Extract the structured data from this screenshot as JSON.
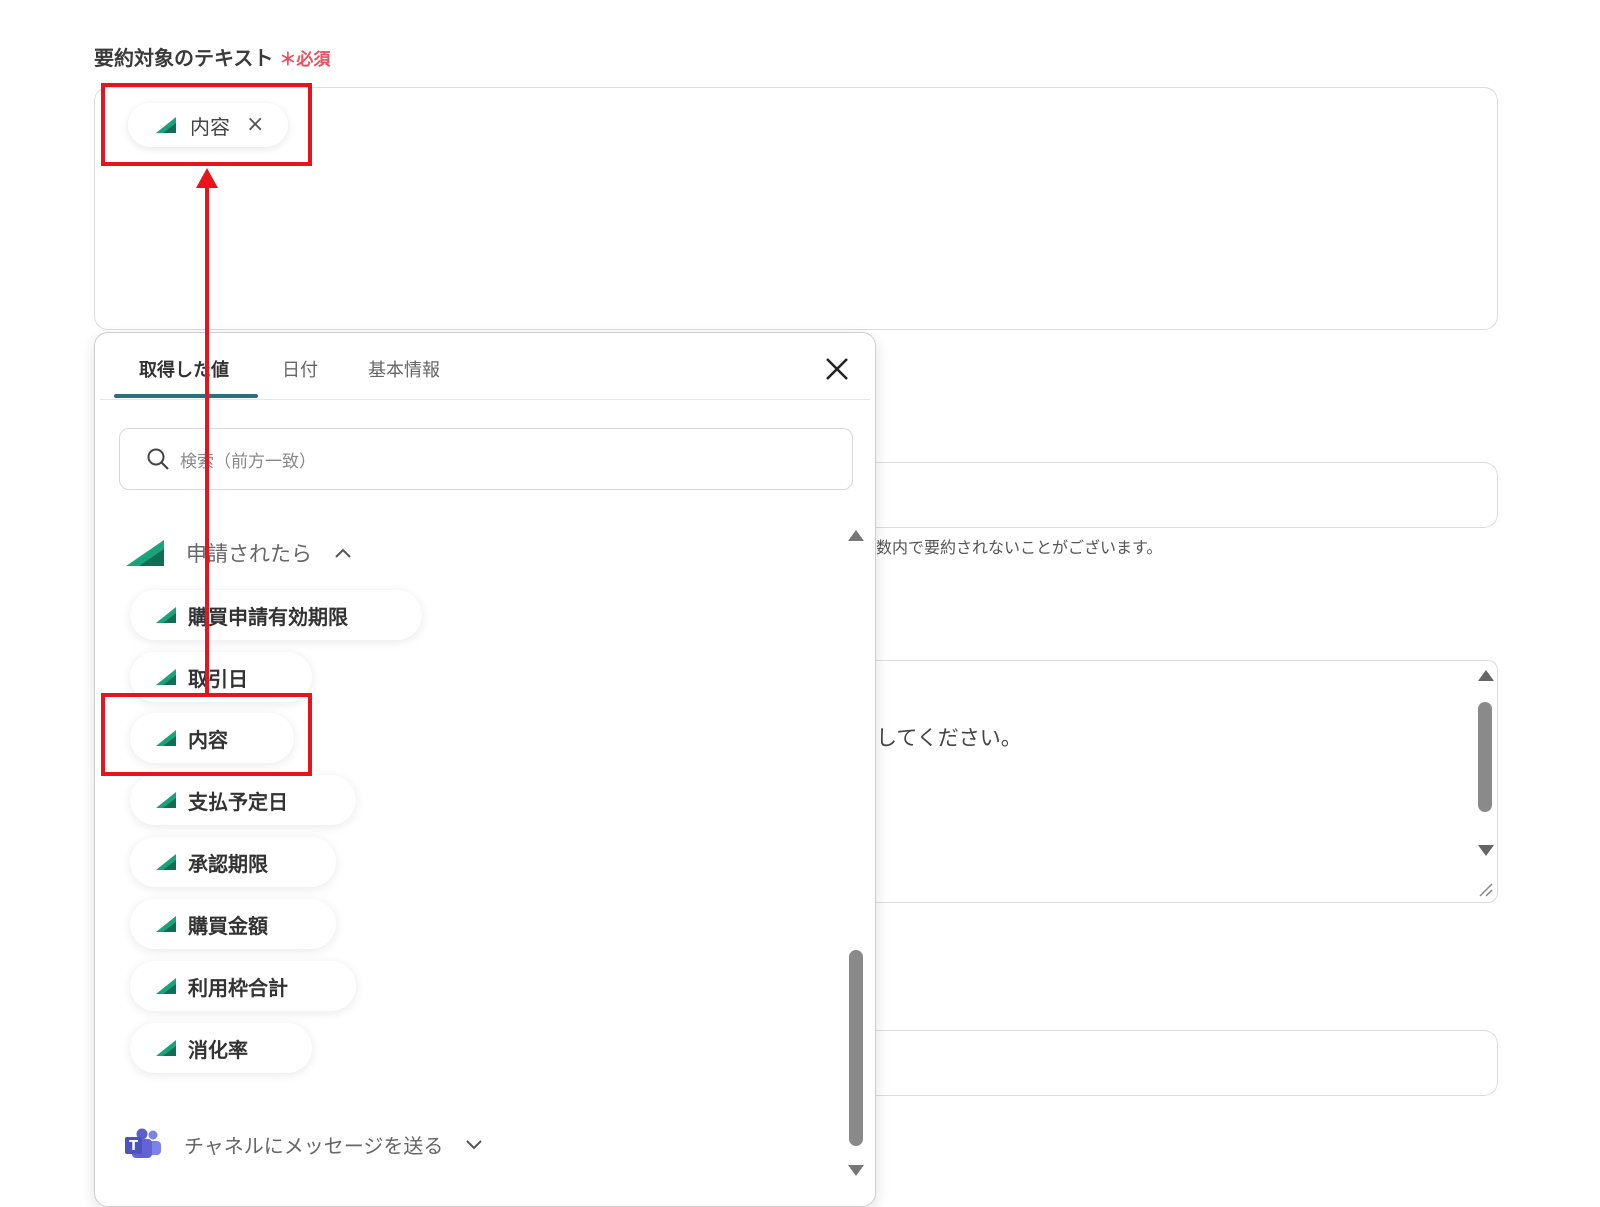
{
  "field": {
    "label": "要約対象のテキスト",
    "required": "＊必須",
    "chip": {
      "label": "内容",
      "remove": "×"
    }
  },
  "background": {
    "note": "数内で要約されないことがございます。",
    "prompt_text": "してください。"
  },
  "popover": {
    "tabs": [
      {
        "label": "取得した値",
        "active": true
      },
      {
        "label": "日付",
        "active": false
      },
      {
        "label": "基本情報",
        "active": false
      }
    ],
    "search": {
      "placeholder": "検索（前方一致）"
    },
    "group": {
      "title": "申請されたら",
      "expanded": true,
      "items": [
        {
          "label": "購買申請有効期限"
        },
        {
          "label": "取引日"
        },
        {
          "label": "内容"
        },
        {
          "label": "支払予定日"
        },
        {
          "label": "承認期限"
        },
        {
          "label": "購買金額"
        },
        {
          "label": "利用枠合計"
        },
        {
          "label": "消化率"
        }
      ]
    },
    "collapsed_group": {
      "title": "チャネルにメッセージを送る",
      "expanded": false
    }
  },
  "colors": {
    "accent_teal": "#2a6f7f",
    "app_icon_green": "#1aa37a",
    "required_red": "#e9505e",
    "annotation_red": "#e8141c",
    "teams_purple": "#5b5fc7"
  }
}
